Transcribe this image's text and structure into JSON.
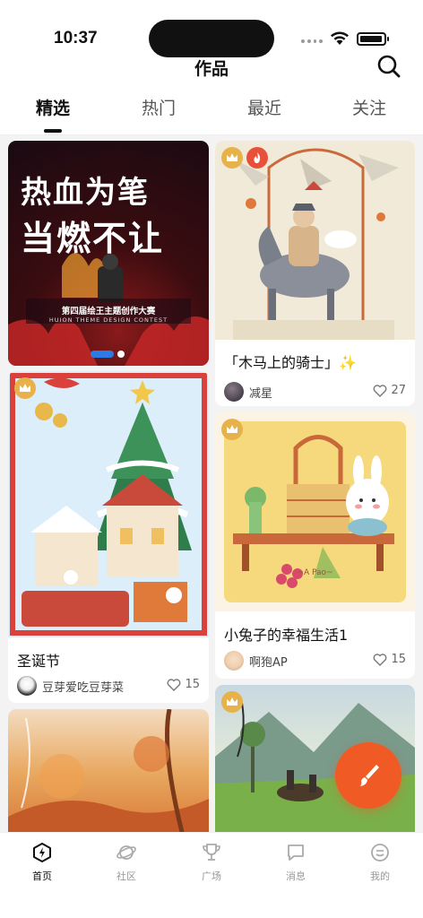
{
  "status_bar": {
    "time": "10:37"
  },
  "header": {
    "title": "作品"
  },
  "tabs": [
    {
      "label": "精选",
      "active": true
    },
    {
      "label": "热门",
      "active": false
    },
    {
      "label": "最近",
      "active": false
    },
    {
      "label": "关注",
      "active": false
    }
  ],
  "banner": {
    "line1": "热血为笔",
    "line2": "当燃不让",
    "subtitle": "第四届绘王主题创作大赛",
    "subtitle_en": "HUION THEME DESIGN CONTEST"
  },
  "posts": [
    {
      "title": "「木马上的骑士」✨",
      "author": "减星",
      "likes": "27",
      "badges": [
        "crown-icon",
        "fire-icon"
      ]
    },
    {
      "title": "圣诞节",
      "author": "豆芽爱吃豆芽菜",
      "likes": "15",
      "badges": [
        "crown-icon"
      ]
    },
    {
      "title": "小兔子的幸福生活1",
      "author": "啊狍AP",
      "likes": "15",
      "badges": [
        "crown-icon"
      ]
    }
  ],
  "art_captions": {
    "rabbit_signature": "~A Pao~"
  },
  "bottom_nav": [
    {
      "label": "首页",
      "icon": "home-icon",
      "active": true
    },
    {
      "label": "社区",
      "icon": "planet-icon",
      "active": false
    },
    {
      "label": "广场",
      "icon": "trophy-icon",
      "active": false
    },
    {
      "label": "消息",
      "icon": "message-icon",
      "active": false
    },
    {
      "label": "我的",
      "icon": "profile-icon",
      "active": false
    }
  ],
  "colors": {
    "accent": "#f05a24",
    "crown": "#e7b24a",
    "fire": "#e8503a",
    "banner_dot": "#2c7be5"
  }
}
